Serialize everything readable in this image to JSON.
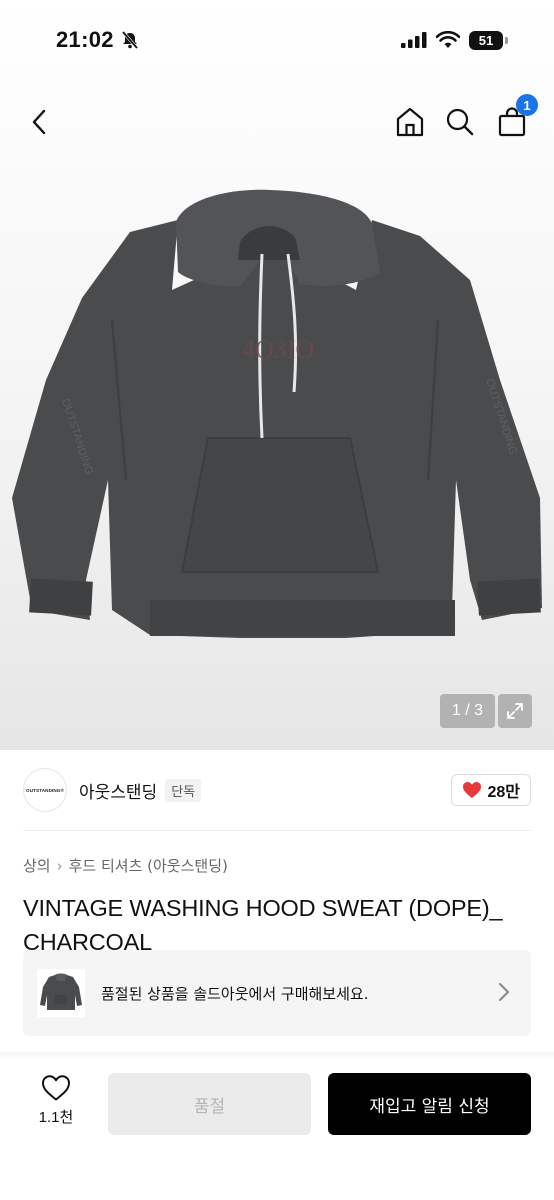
{
  "status_bar": {
    "time": "21:02",
    "battery": "51"
  },
  "top_nav": {
    "cart_count": "1"
  },
  "gallery": {
    "pager": "1 / 3"
  },
  "brand": {
    "logo_text": "OUTSTANDING®",
    "name": "아웃스탠딩",
    "tag": "단독",
    "likes": "28만"
  },
  "breadcrumb": [
    "상의",
    "후드 티셔츠 (아웃스탠딩)"
  ],
  "product": {
    "title": "VINTAGE WASHING HOOD SWEAT (DOPE)_ CHARCOAL"
  },
  "soldout_banner": {
    "text": "품절된 상품을 솔드아웃에서 구매해보세요."
  },
  "action_bar": {
    "wish_count": "1.1천",
    "sold_out_label": "품절",
    "restock_label": "재입고 알림 신청"
  },
  "colors": {
    "accent": "#1a73e8",
    "heart": "#e8383d",
    "primary_button": "#000000",
    "disabled_button": "#ebebeb"
  }
}
